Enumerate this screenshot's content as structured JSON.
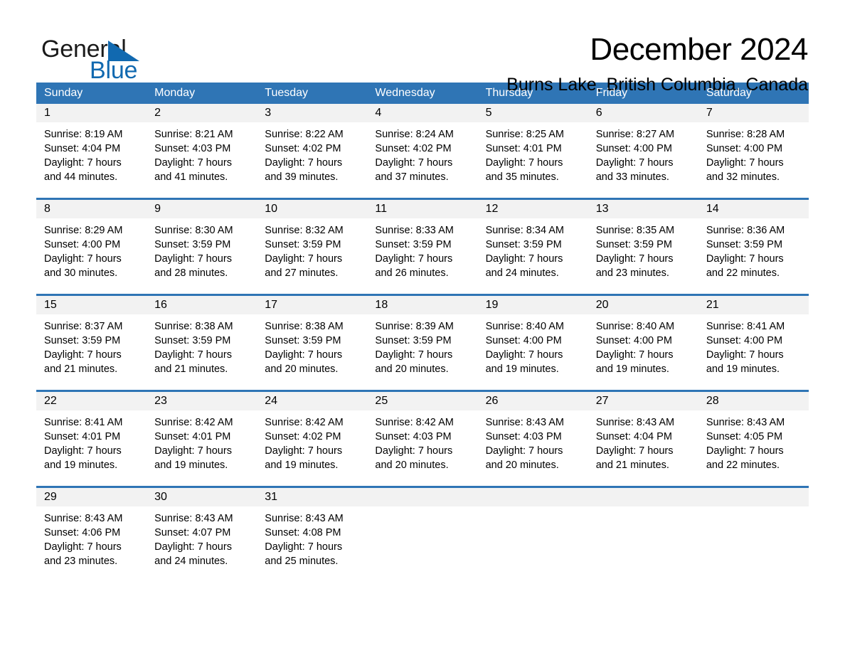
{
  "brand": {
    "name_part1": "General",
    "name_part2": "Blue",
    "triangle_color": "#1169b0",
    "text_color": "#1a1a1a"
  },
  "header": {
    "title": "December 2024",
    "subtitle": "Burns Lake, British Columbia, Canada"
  },
  "theme": {
    "header_blue": "#2f75b5",
    "date_band": "#f2f2f2",
    "separator_blue": "#2f75b5"
  },
  "columns": [
    "Sunday",
    "Monday",
    "Tuesday",
    "Wednesday",
    "Thursday",
    "Friday",
    "Saturday"
  ],
  "weeks": [
    [
      {
        "day": "1",
        "sunrise": "Sunrise: 8:19 AM",
        "sunset": "Sunset: 4:04 PM",
        "daylight1": "Daylight: 7 hours",
        "daylight2": "and 44 minutes."
      },
      {
        "day": "2",
        "sunrise": "Sunrise: 8:21 AM",
        "sunset": "Sunset: 4:03 PM",
        "daylight1": "Daylight: 7 hours",
        "daylight2": "and 41 minutes."
      },
      {
        "day": "3",
        "sunrise": "Sunrise: 8:22 AM",
        "sunset": "Sunset: 4:02 PM",
        "daylight1": "Daylight: 7 hours",
        "daylight2": "and 39 minutes."
      },
      {
        "day": "4",
        "sunrise": "Sunrise: 8:24 AM",
        "sunset": "Sunset: 4:02 PM",
        "daylight1": "Daylight: 7 hours",
        "daylight2": "and 37 minutes."
      },
      {
        "day": "5",
        "sunrise": "Sunrise: 8:25 AM",
        "sunset": "Sunset: 4:01 PM",
        "daylight1": "Daylight: 7 hours",
        "daylight2": "and 35 minutes."
      },
      {
        "day": "6",
        "sunrise": "Sunrise: 8:27 AM",
        "sunset": "Sunset: 4:00 PM",
        "daylight1": "Daylight: 7 hours",
        "daylight2": "and 33 minutes."
      },
      {
        "day": "7",
        "sunrise": "Sunrise: 8:28 AM",
        "sunset": "Sunset: 4:00 PM",
        "daylight1": "Daylight: 7 hours",
        "daylight2": "and 32 minutes."
      }
    ],
    [
      {
        "day": "8",
        "sunrise": "Sunrise: 8:29 AM",
        "sunset": "Sunset: 4:00 PM",
        "daylight1": "Daylight: 7 hours",
        "daylight2": "and 30 minutes."
      },
      {
        "day": "9",
        "sunrise": "Sunrise: 8:30 AM",
        "sunset": "Sunset: 3:59 PM",
        "daylight1": "Daylight: 7 hours",
        "daylight2": "and 28 minutes."
      },
      {
        "day": "10",
        "sunrise": "Sunrise: 8:32 AM",
        "sunset": "Sunset: 3:59 PM",
        "daylight1": "Daylight: 7 hours",
        "daylight2": "and 27 minutes."
      },
      {
        "day": "11",
        "sunrise": "Sunrise: 8:33 AM",
        "sunset": "Sunset: 3:59 PM",
        "daylight1": "Daylight: 7 hours",
        "daylight2": "and 26 minutes."
      },
      {
        "day": "12",
        "sunrise": "Sunrise: 8:34 AM",
        "sunset": "Sunset: 3:59 PM",
        "daylight1": "Daylight: 7 hours",
        "daylight2": "and 24 minutes."
      },
      {
        "day": "13",
        "sunrise": "Sunrise: 8:35 AM",
        "sunset": "Sunset: 3:59 PM",
        "daylight1": "Daylight: 7 hours",
        "daylight2": "and 23 minutes."
      },
      {
        "day": "14",
        "sunrise": "Sunrise: 8:36 AM",
        "sunset": "Sunset: 3:59 PM",
        "daylight1": "Daylight: 7 hours",
        "daylight2": "and 22 minutes."
      }
    ],
    [
      {
        "day": "15",
        "sunrise": "Sunrise: 8:37 AM",
        "sunset": "Sunset: 3:59 PM",
        "daylight1": "Daylight: 7 hours",
        "daylight2": "and 21 minutes."
      },
      {
        "day": "16",
        "sunrise": "Sunrise: 8:38 AM",
        "sunset": "Sunset: 3:59 PM",
        "daylight1": "Daylight: 7 hours",
        "daylight2": "and 21 minutes."
      },
      {
        "day": "17",
        "sunrise": "Sunrise: 8:38 AM",
        "sunset": "Sunset: 3:59 PM",
        "daylight1": "Daylight: 7 hours",
        "daylight2": "and 20 minutes."
      },
      {
        "day": "18",
        "sunrise": "Sunrise: 8:39 AM",
        "sunset": "Sunset: 3:59 PM",
        "daylight1": "Daylight: 7 hours",
        "daylight2": "and 20 minutes."
      },
      {
        "day": "19",
        "sunrise": "Sunrise: 8:40 AM",
        "sunset": "Sunset: 4:00 PM",
        "daylight1": "Daylight: 7 hours",
        "daylight2": "and 19 minutes."
      },
      {
        "day": "20",
        "sunrise": "Sunrise: 8:40 AM",
        "sunset": "Sunset: 4:00 PM",
        "daylight1": "Daylight: 7 hours",
        "daylight2": "and 19 minutes."
      },
      {
        "day": "21",
        "sunrise": "Sunrise: 8:41 AM",
        "sunset": "Sunset: 4:00 PM",
        "daylight1": "Daylight: 7 hours",
        "daylight2": "and 19 minutes."
      }
    ],
    [
      {
        "day": "22",
        "sunrise": "Sunrise: 8:41 AM",
        "sunset": "Sunset: 4:01 PM",
        "daylight1": "Daylight: 7 hours",
        "daylight2": "and 19 minutes."
      },
      {
        "day": "23",
        "sunrise": "Sunrise: 8:42 AM",
        "sunset": "Sunset: 4:01 PM",
        "daylight1": "Daylight: 7 hours",
        "daylight2": "and 19 minutes."
      },
      {
        "day": "24",
        "sunrise": "Sunrise: 8:42 AM",
        "sunset": "Sunset: 4:02 PM",
        "daylight1": "Daylight: 7 hours",
        "daylight2": "and 19 minutes."
      },
      {
        "day": "25",
        "sunrise": "Sunrise: 8:42 AM",
        "sunset": "Sunset: 4:03 PM",
        "daylight1": "Daylight: 7 hours",
        "daylight2": "and 20 minutes."
      },
      {
        "day": "26",
        "sunrise": "Sunrise: 8:43 AM",
        "sunset": "Sunset: 4:03 PM",
        "daylight1": "Daylight: 7 hours",
        "daylight2": "and 20 minutes."
      },
      {
        "day": "27",
        "sunrise": "Sunrise: 8:43 AM",
        "sunset": "Sunset: 4:04 PM",
        "daylight1": "Daylight: 7 hours",
        "daylight2": "and 21 minutes."
      },
      {
        "day": "28",
        "sunrise": "Sunrise: 8:43 AM",
        "sunset": "Sunset: 4:05 PM",
        "daylight1": "Daylight: 7 hours",
        "daylight2": "and 22 minutes."
      }
    ],
    [
      {
        "day": "29",
        "sunrise": "Sunrise: 8:43 AM",
        "sunset": "Sunset: 4:06 PM",
        "daylight1": "Daylight: 7 hours",
        "daylight2": "and 23 minutes."
      },
      {
        "day": "30",
        "sunrise": "Sunrise: 8:43 AM",
        "sunset": "Sunset: 4:07 PM",
        "daylight1": "Daylight: 7 hours",
        "daylight2": "and 24 minutes."
      },
      {
        "day": "31",
        "sunrise": "Sunrise: 8:43 AM",
        "sunset": "Sunset: 4:08 PM",
        "daylight1": "Daylight: 7 hours",
        "daylight2": "and 25 minutes."
      },
      {
        "day": "",
        "sunrise": "",
        "sunset": "",
        "daylight1": "",
        "daylight2": ""
      },
      {
        "day": "",
        "sunrise": "",
        "sunset": "",
        "daylight1": "",
        "daylight2": ""
      },
      {
        "day": "",
        "sunrise": "",
        "sunset": "",
        "daylight1": "",
        "daylight2": ""
      },
      {
        "day": "",
        "sunrise": "",
        "sunset": "",
        "daylight1": "",
        "daylight2": ""
      }
    ]
  ]
}
